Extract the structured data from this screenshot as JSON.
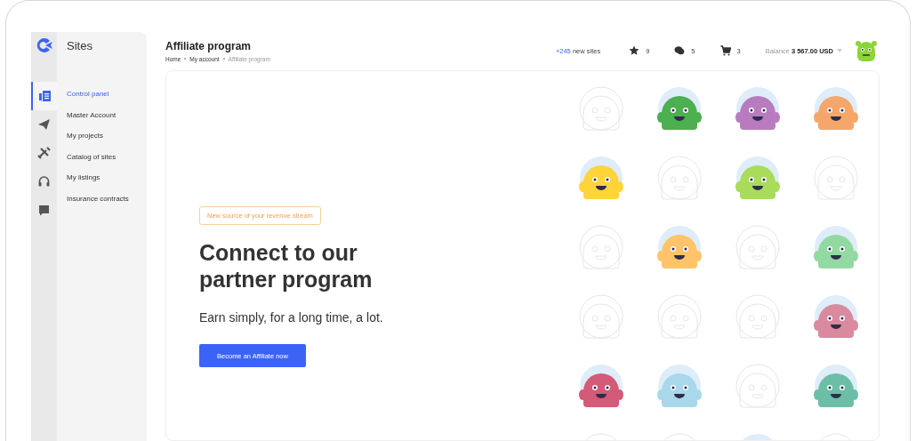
{
  "sidebar": {
    "title": "Sites",
    "rail": [
      {
        "kind": "dashboard",
        "selected": true
      },
      {
        "kind": "send",
        "selected": false
      },
      {
        "kind": "tools",
        "selected": false
      },
      {
        "kind": "headset",
        "selected": false
      },
      {
        "kind": "message",
        "selected": false
      }
    ],
    "items": [
      {
        "label": "Control panel",
        "selected": true
      },
      {
        "label": "Master Account",
        "selected": false
      },
      {
        "label": "My projects",
        "selected": false
      },
      {
        "label": "Catalog of sites",
        "selected": false
      },
      {
        "label": "My listings",
        "selected": false
      },
      {
        "label": "Insurance contracts",
        "selected": false
      }
    ]
  },
  "header": {
    "title": "Affiliate program",
    "breadcrumb": [
      "Home",
      "My account",
      "Affiliate program"
    ],
    "new_sites": {
      "count": "+245",
      "label": "new sites"
    },
    "counters": [
      {
        "kind": "star",
        "value": "9"
      },
      {
        "kind": "chat",
        "value": "5"
      },
      {
        "kind": "cart",
        "value": "3"
      }
    ],
    "balance": {
      "label": "Balance",
      "amount": "3 567.00 USD"
    }
  },
  "promo": {
    "tag": "New source of your revenue stream",
    "heading": "Connect to our partner program",
    "subtitle": "Earn simply, for a long time, a lot.",
    "button": "Become an Affiliate now"
  },
  "monsters": [
    {
      "kind": "outline"
    },
    {
      "kind": "filled",
      "color": "#4caf50"
    },
    {
      "kind": "filled",
      "color": "#b97bbf"
    },
    {
      "kind": "filled",
      "color": "#f5a66a"
    },
    {
      "kind": "filled",
      "color": "#ffd43b"
    },
    {
      "kind": "outline"
    },
    {
      "kind": "filled",
      "color": "#a8dc5a"
    },
    {
      "kind": "outline"
    },
    {
      "kind": "outline"
    },
    {
      "kind": "filled",
      "color": "#ffc469"
    },
    {
      "kind": "outline"
    },
    {
      "kind": "filled",
      "color": "#93d9a2"
    },
    {
      "kind": "outline"
    },
    {
      "kind": "outline"
    },
    {
      "kind": "outline"
    },
    {
      "kind": "filled",
      "color": "#d98a9e"
    },
    {
      "kind": "filled",
      "color": "#d35a78"
    },
    {
      "kind": "filled",
      "color": "#a8d8ea"
    },
    {
      "kind": "outline"
    },
    {
      "kind": "filled",
      "color": "#6cbfa6"
    },
    {
      "kind": "outline"
    },
    {
      "kind": "outline"
    },
    {
      "kind": "filled"
    },
    {
      "kind": "outline"
    }
  ]
}
